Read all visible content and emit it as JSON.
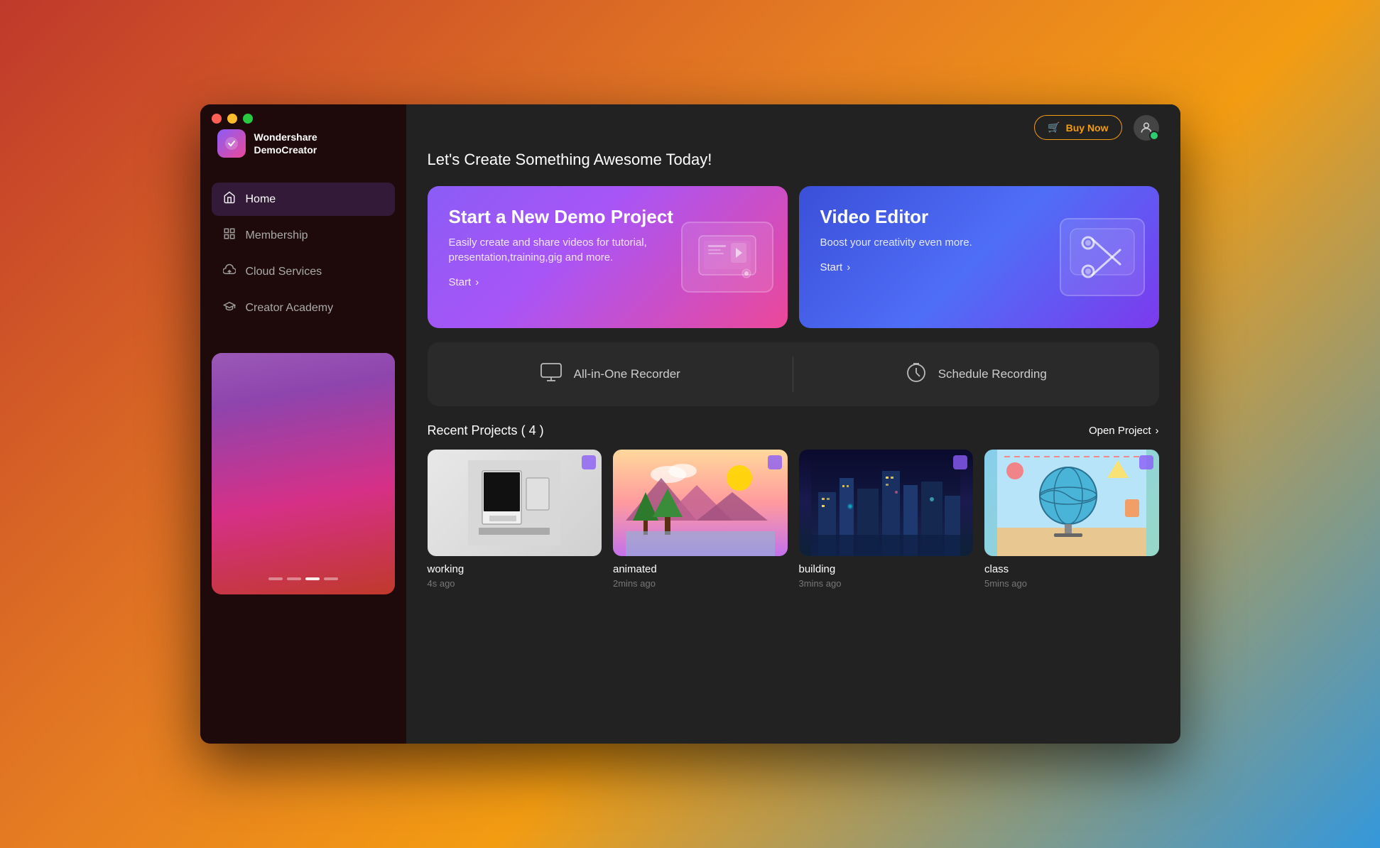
{
  "app": {
    "name_line1": "Wondershare",
    "name_line2": "DemoCreator"
  },
  "window": {
    "traffic_lights": [
      "red",
      "yellow",
      "green"
    ]
  },
  "header": {
    "page_title": "Let's Create Something Awesome Today!",
    "buy_now": "Buy Now"
  },
  "nav": {
    "items": [
      {
        "id": "home",
        "label": "Home",
        "active": true,
        "icon": "🏠"
      },
      {
        "id": "membership",
        "label": "Membership",
        "active": false,
        "icon": "⊞"
      },
      {
        "id": "cloud-services",
        "label": "Cloud Services",
        "active": false,
        "icon": "☁"
      },
      {
        "id": "creator-academy",
        "label": "Creator Academy",
        "active": false,
        "icon": "🎓"
      }
    ]
  },
  "hero": {
    "demo_card": {
      "title": "Start a New Demo Project",
      "description": "Easily create and share videos for tutorial, presentation,training,gig and more.",
      "link": "Start"
    },
    "editor_card": {
      "title": "Video Editor",
      "description": "Boost your creativity even more.",
      "link": "Start"
    }
  },
  "recorder": {
    "all_in_one": "All-in-One Recorder",
    "schedule": "Schedule Recording"
  },
  "recent": {
    "title": "Recent Projects",
    "count": 4,
    "open_project": "Open Project",
    "projects": [
      {
        "name": "working",
        "time": "4s ago",
        "thumb": "working"
      },
      {
        "name": "animated",
        "time": "2mins ago",
        "thumb": "animated"
      },
      {
        "name": "building",
        "time": "3mins ago",
        "thumb": "building"
      },
      {
        "name": "class",
        "time": "5mins ago",
        "thumb": "class"
      }
    ]
  },
  "colors": {
    "accent_purple": "#8b5cf6",
    "accent_pink": "#ec4899",
    "accent_orange": "#f39c12",
    "bg_sidebar": "#1e0a0a",
    "bg_main": "#222222",
    "bg_card": "#2a2a2a"
  }
}
